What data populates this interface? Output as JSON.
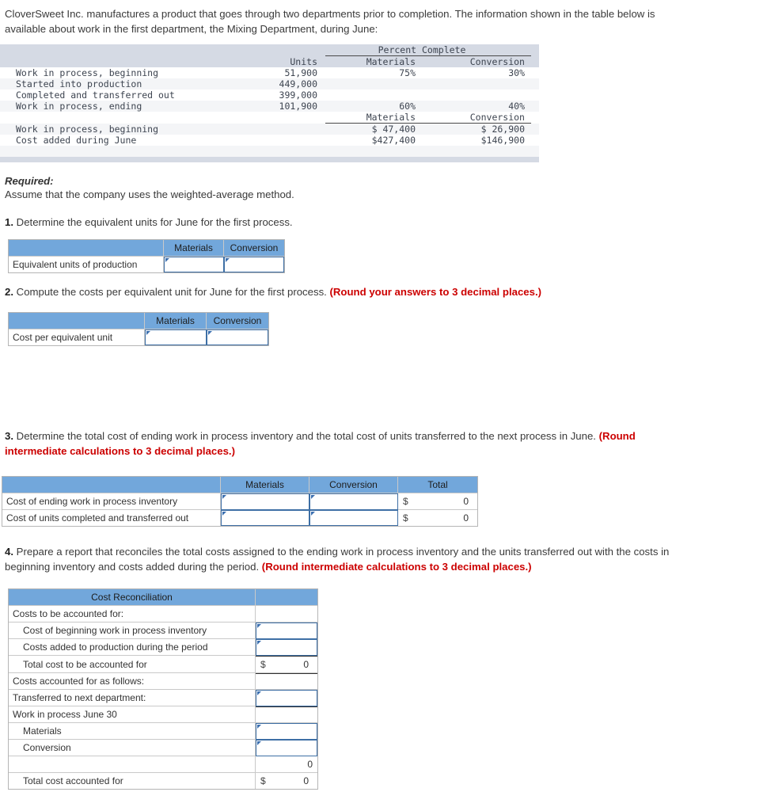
{
  "intro": {
    "paragraph": "CloverSweet Inc. manufactures a product that goes through two departments prior to completion. The information shown in the table below is available about work in the first department, the Mixing Department, during June:"
  },
  "problem_table": {
    "group_header": "Percent Complete",
    "columns": {
      "units": "Units",
      "materials": "Materials",
      "conversion": "Conversion"
    },
    "unit_rows": [
      {
        "label": "Work in process, beginning",
        "units": "51,900",
        "materials": "75%",
        "conversion": "30%"
      },
      {
        "label": "Started into production",
        "units": "449,000",
        "materials": "",
        "conversion": ""
      },
      {
        "label": "Completed and transferred out",
        "units": "399,000",
        "materials": "",
        "conversion": ""
      },
      {
        "label": "Work in process, ending",
        "units": "101,900",
        "materials": "60%",
        "conversion": "40%"
      }
    ],
    "cost_header": {
      "materials": "Materials",
      "conversion": "Conversion"
    },
    "cost_rows": [
      {
        "label": "Work in process, beginning",
        "materials": "$ 47,400",
        "conversion": "$ 26,900"
      },
      {
        "label": "Cost added during June",
        "materials": "$427,400",
        "conversion": "$146,900"
      }
    ]
  },
  "required": {
    "title": "Required:",
    "subtitle": "Assume that the company uses the weighted-average method."
  },
  "q1": {
    "number": "1.",
    "text": "Determine the equivalent units for June for the first process.",
    "table": {
      "headers": {
        "blank": "",
        "materials": "Materials",
        "conversion": "Conversion"
      },
      "rows": [
        {
          "label": "Equivalent units of production",
          "materials": "",
          "conversion": ""
        }
      ]
    }
  },
  "q2": {
    "number": "2.",
    "text": "Compute the costs per equivalent unit for June for the first process.",
    "note": "(Round your answers to 3 decimal places.)",
    "table": {
      "headers": {
        "blank": "",
        "materials": "Materials",
        "conversion": "Conversion"
      },
      "rows": [
        {
          "label": "Cost per equivalent unit",
          "materials": "",
          "conversion": ""
        }
      ]
    }
  },
  "q3": {
    "number": "3.",
    "text": "Determine the total cost of ending work in process inventory and the total cost of units transferred to the next process in June.",
    "note": "(Round intermediate calculations to 3 decimal places.)",
    "table": {
      "headers": {
        "blank": "",
        "materials": "Materials",
        "conversion": "Conversion",
        "total": "Total"
      },
      "rows": [
        {
          "label": "Cost of ending work in process inventory",
          "materials": "",
          "conversion": "",
          "total_symbol": "$",
          "total_value": "0"
        },
        {
          "label": "Cost of units completed and transferred out",
          "materials": "",
          "conversion": "",
          "total_symbol": "$",
          "total_value": "0"
        }
      ]
    }
  },
  "q4": {
    "number": "4.",
    "text": "Prepare a report that reconciles the total costs assigned to the ending work in process inventory and the units transferred out with the costs in beginning inventory and costs added during the period.",
    "note": "(Round intermediate calculations to 3 decimal places.)",
    "table": {
      "title": "Cost Reconciliation",
      "rows": [
        {
          "label": "Costs to be accounted for:",
          "kind": "section",
          "value": ""
        },
        {
          "label": "Cost of beginning work in process inventory",
          "kind": "input",
          "value": ""
        },
        {
          "label": "Costs added to production during the period",
          "kind": "input",
          "value": ""
        },
        {
          "label": "Total cost to be accounted for",
          "kind": "total",
          "symbol": "$",
          "value": "0"
        },
        {
          "label": "Costs accounted for as follows:",
          "kind": "section",
          "value": ""
        },
        {
          "label": "Transferred to next department:",
          "kind": "input",
          "value": ""
        },
        {
          "label": "Work in process June 30",
          "kind": "section",
          "value": ""
        },
        {
          "label": "Materials",
          "kind": "input",
          "value": ""
        },
        {
          "label": "Conversion",
          "kind": "input",
          "value": ""
        },
        {
          "label": "",
          "kind": "subtotal",
          "symbol": "",
          "value": "0"
        },
        {
          "label": "Total cost accounted for",
          "kind": "grand",
          "symbol": "$",
          "value": "0"
        }
      ]
    }
  },
  "colors": {
    "header_blue": "#72a7db",
    "shade_gray": "#d5dae4",
    "zebra_gray": "#f4f5f7",
    "note_red": "#cc0000",
    "input_border": "#3e6fa5"
  }
}
